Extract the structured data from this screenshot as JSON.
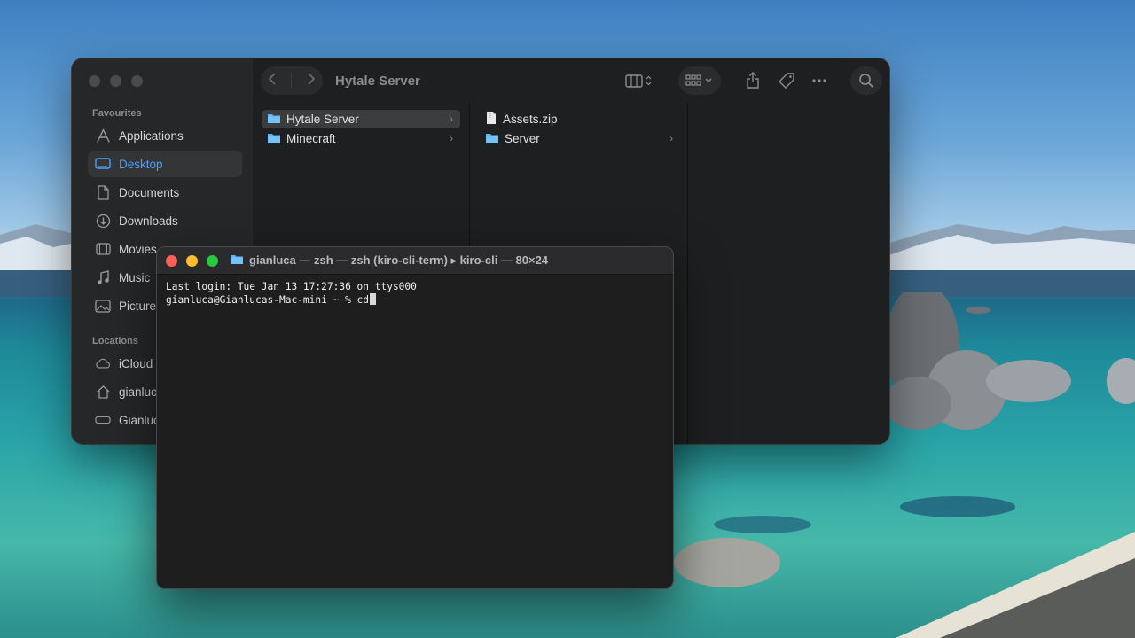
{
  "colors": {
    "accent": "#4e9ff5",
    "finder_bg": "#1e1f20",
    "sidebar_bg": "#262728",
    "terminal_bg": "#1e1e1e",
    "traffic_red": "#ff5f57",
    "traffic_yellow": "#febc2e",
    "traffic_green": "#28c840",
    "folder_blue": "#5fb3f2"
  },
  "finder": {
    "title": "Hytale Server",
    "sidebar": {
      "favourites_heading": "Favourites",
      "favourites": [
        {
          "label": "Applications",
          "icon": "applications-icon"
        },
        {
          "label": "Desktop",
          "icon": "desktop-icon",
          "selected": true
        },
        {
          "label": "Documents",
          "icon": "document-icon"
        },
        {
          "label": "Downloads",
          "icon": "downloads-icon"
        },
        {
          "label": "Movies",
          "icon": "film-icon"
        },
        {
          "label": "Music",
          "icon": "music-note-icon"
        },
        {
          "label": "Pictures",
          "icon": "photo-icon"
        }
      ],
      "locations_heading": "Locations",
      "locations": [
        {
          "label": "iCloud",
          "icon": "cloud-icon"
        },
        {
          "label": "gianluca",
          "icon": "home-icon"
        },
        {
          "label": "Gianluca",
          "icon": "drive-icon"
        }
      ]
    },
    "columns": [
      [
        {
          "label": "Hytale Server",
          "type": "folder",
          "selected": true,
          "has_children": true
        },
        {
          "label": "Minecraft",
          "type": "folder",
          "has_children": true
        }
      ],
      [
        {
          "label": "Assets.zip",
          "type": "file",
          "has_children": false
        },
        {
          "label": "Server",
          "type": "folder",
          "has_children": true
        }
      ]
    ]
  },
  "terminal": {
    "title": "gianluca — zsh — zsh (kiro-cli-term) ▸ kiro-cli — 80×24",
    "lines": [
      "Last login: Tue Jan 13 17:27:36 on ttys000",
      "gianluca@Gianlucas-Mac-mini ~ % cd"
    ]
  }
}
